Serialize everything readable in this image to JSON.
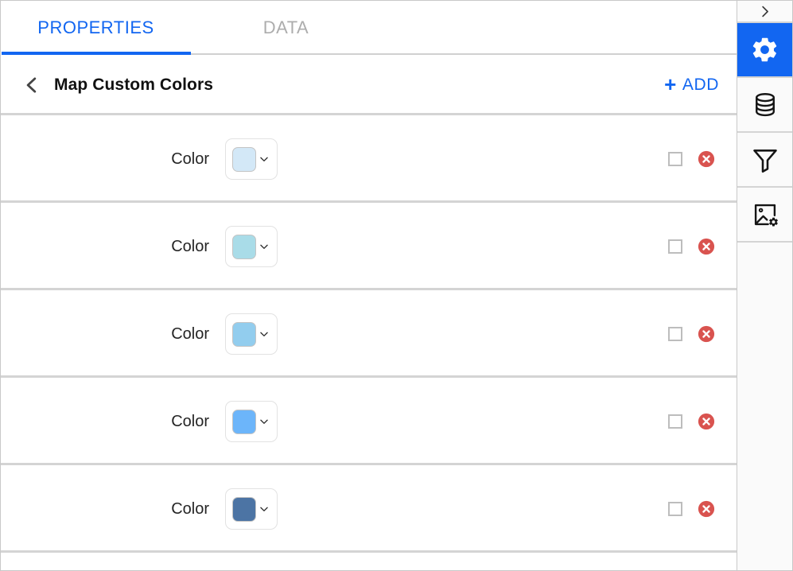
{
  "tabs": [
    {
      "label": "PROPERTIES",
      "active": true
    },
    {
      "label": "DATA",
      "active": false
    }
  ],
  "section": {
    "title": "Map Custom Colors",
    "back_icon": "chevron-left-icon",
    "add_label": "ADD",
    "add_plus": "+",
    "accent_color": "#1266f1"
  },
  "rows": [
    {
      "label": "Color",
      "swatch": "#d3e8f7",
      "checked": false,
      "chevron_icon": "chevron-down-icon",
      "delete_icon": "delete-circle-icon"
    },
    {
      "label": "Color",
      "swatch": "#a9dce8",
      "checked": false,
      "chevron_icon": "chevron-down-icon",
      "delete_icon": "delete-circle-icon"
    },
    {
      "label": "Color",
      "swatch": "#92cdee",
      "checked": false,
      "chevron_icon": "chevron-down-icon",
      "delete_icon": "delete-circle-icon"
    },
    {
      "label": "Color",
      "swatch": "#6cb5fa",
      "checked": false,
      "chevron_icon": "chevron-down-icon",
      "delete_icon": "delete-circle-icon"
    },
    {
      "label": "Color",
      "swatch": "#4c74a4",
      "checked": false,
      "chevron_icon": "chevron-down-icon",
      "delete_icon": "delete-circle-icon"
    }
  ],
  "toolbar": {
    "items": [
      {
        "icon": "chevron-right-icon",
        "active": false
      },
      {
        "icon": "gear-icon",
        "active": true
      },
      {
        "icon": "database-icon",
        "active": false
      },
      {
        "icon": "filter-funnel-icon",
        "active": false
      },
      {
        "icon": "image-settings-icon",
        "active": false
      }
    ]
  },
  "colors": {
    "accent": "#1266f1",
    "delete": "#d9534f",
    "divider": "#d4d4d4",
    "inactive_tab": "#adadad"
  }
}
